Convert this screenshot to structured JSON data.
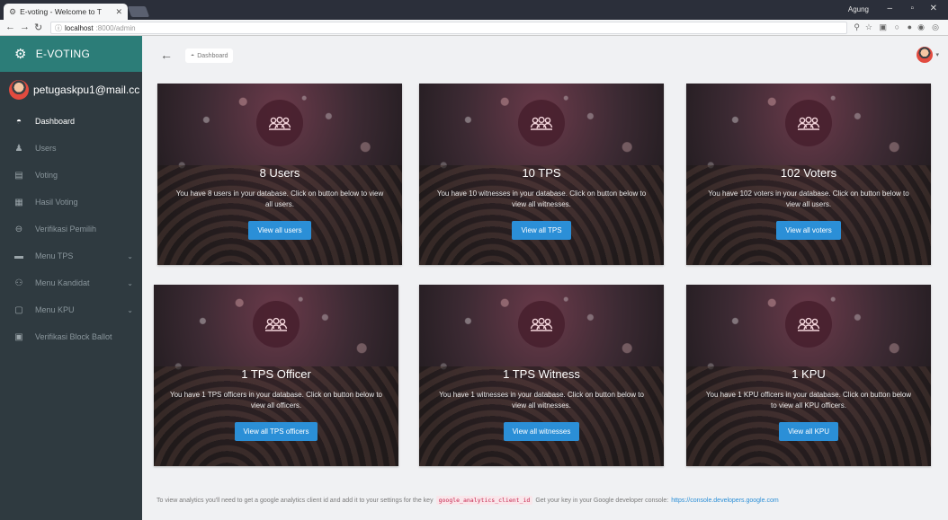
{
  "browser": {
    "tab_title": "E-voting - Welcome to T",
    "url_host": "localhost",
    "url_path": ":8000/admin",
    "window_user": "Agung"
  },
  "sidebar": {
    "brand": "E-VOTING",
    "user_email": "petugaskpu1@mail.cc",
    "items": [
      {
        "label": "Dashboard",
        "icon": "dashboard-icon"
      },
      {
        "label": "Users",
        "icon": "user-icon"
      },
      {
        "label": "Voting",
        "icon": "ballot-icon"
      },
      {
        "label": "Hasil Voting",
        "icon": "results-icon"
      },
      {
        "label": "Verifikasi Pemilih",
        "icon": "lock-icon"
      },
      {
        "label": "Menu TPS",
        "icon": "folder-icon"
      },
      {
        "label": "Menu Kandidat",
        "icon": "group-icon"
      },
      {
        "label": "Menu KPU",
        "icon": "document-icon"
      },
      {
        "label": "Verifikasi Block Ballot",
        "icon": "document-icon"
      }
    ]
  },
  "header": {
    "breadcrumb": "Dashboard"
  },
  "cards": [
    {
      "title": "8 Users",
      "desc": "You have 8 users in your database. Click on button below to view all users.",
      "button": "View all users"
    },
    {
      "title": "10 TPS",
      "desc": "You have 10 witnesses in your database. Click on button below to view all witnesses.",
      "button": "View all TPS"
    },
    {
      "title": "102 Voters",
      "desc": "You have 102 voters in your database. Click on button below to view all users.",
      "button": "View all voters"
    },
    {
      "title": "1 TPS Officer",
      "desc": "You have 1 TPS officers in your database. Click on button below to view all officers.",
      "button": "View all TPS officers"
    },
    {
      "title": "1 TPS Witness",
      "desc": "You have 1 witnesses in your database. Click on button below to view all witnesses.",
      "button": "View all witnesses"
    },
    {
      "title": "1 KPU",
      "desc": "You have 1 KPU officers in your database. Click on button below to view all KPU officers.",
      "button": "View all KPU"
    }
  ],
  "footer": {
    "text_before": "To view analytics you'll need to get a google analytics client id and add it to your settings for the key",
    "key": "google_analytics_client_id",
    "text_after": "Get your key in your Google developer console:",
    "link": "https://console.developers.google.com"
  },
  "colors": {
    "brand_bar": "#2c7d78",
    "sidebar_bg": "#2f3a40",
    "button_blue": "#2b8fd7"
  }
}
